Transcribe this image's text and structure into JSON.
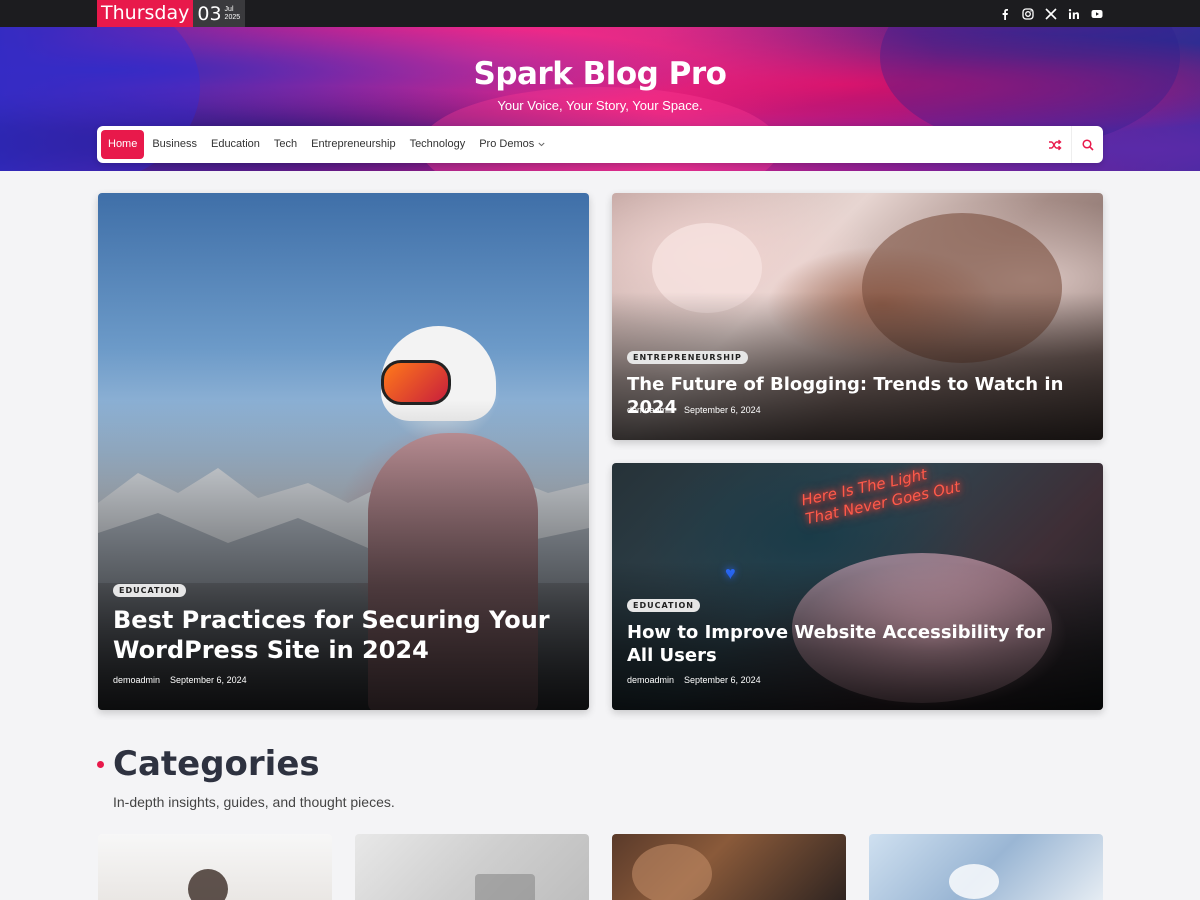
{
  "topbar": {
    "date": {
      "day_name": "Thursday",
      "day": "03",
      "month": "Jul",
      "year": "2025"
    },
    "socials": [
      "facebook-icon",
      "instagram-icon",
      "x-icon",
      "linkedin-icon",
      "youtube-icon"
    ]
  },
  "header": {
    "title": "Spark Blog Pro",
    "tagline": "Your Voice, Your Story, Your Space."
  },
  "nav": {
    "items": [
      {
        "label": "Home",
        "active": true
      },
      {
        "label": "Business"
      },
      {
        "label": "Education"
      },
      {
        "label": "Tech"
      },
      {
        "label": "Entrepreneurship"
      },
      {
        "label": "Technology"
      },
      {
        "label": "Pro Demos",
        "has_dropdown": true
      }
    ],
    "tools": [
      "shuffle-icon",
      "search-icon"
    ]
  },
  "featured": {
    "main": {
      "category": "EDUCATION",
      "title": "Best Practices for Securing Your WordPress Site in 2024",
      "author": "demoadmin",
      "date": "September 6, 2024"
    },
    "side1": {
      "category": "ENTREPRENEURSHIP",
      "title": "The Future of Blogging: Trends to Watch in 2024",
      "author": "demoadmin",
      "date": "September 6, 2024"
    },
    "side2": {
      "category": "EDUCATION",
      "title": "How to Improve Website Accessibility for All Users",
      "author": "demoadmin",
      "date": "September 6, 2024",
      "neon_sign": "Here Is The Light That Never Goes Out"
    }
  },
  "categories": {
    "title": "Categories",
    "subtitle": "In-depth insights, guides, and thought pieces."
  },
  "colors": {
    "accent": "#e8194b",
    "topbar": "#1c1c1f"
  }
}
